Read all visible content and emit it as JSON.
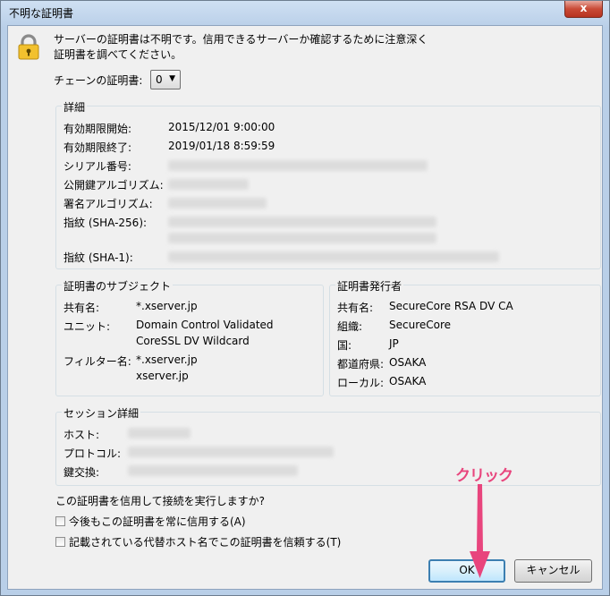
{
  "window": {
    "title": "不明な証明書",
    "close_label": "x"
  },
  "message": {
    "line1": "サーバーの証明書は不明です。信用できるサーバーか確認するために注意深く",
    "line2": "証明書を調べてください。"
  },
  "chain": {
    "label": "チェーンの証明書:",
    "selected": "0"
  },
  "details": {
    "legend": "詳細",
    "rows": [
      {
        "label": "有効期限開始:",
        "value": "2015/12/01 9:00:00"
      },
      {
        "label": "有効期限終了:",
        "value": "2019/01/18 8:59:59"
      },
      {
        "label": "シリアル番号:",
        "value": ""
      },
      {
        "label": "公開鍵アルゴリズム:",
        "value": ""
      },
      {
        "label": "署名アルゴリズム:",
        "value": ""
      },
      {
        "label": "指紋 (SHA-256):",
        "value": ""
      },
      {
        "label": "指紋 (SHA-1):",
        "value": ""
      }
    ]
  },
  "subject": {
    "legend": "証明書のサブジェクト",
    "cn_label": "共有名:",
    "cn_value": "*.xserver.jp",
    "unit_label": "ユニット:",
    "unit_value1": "Domain Control Validated",
    "unit_value2": "CoreSSL DV Wildcard",
    "filter_label": "フィルター名:",
    "filter_value1": "*.xserver.jp",
    "filter_value2": "xserver.jp"
  },
  "issuer": {
    "legend": "証明書発行者",
    "cn_label": "共有名:",
    "cn_value": "SecureCore RSA DV CA",
    "org_label": "組織:",
    "org_value": "SecureCore",
    "country_label": "国:",
    "country_value": "JP",
    "state_label": "都道府県:",
    "state_value": "OSAKA",
    "local_label": "ローカル:",
    "local_value": "OSAKA"
  },
  "session": {
    "legend": "セッション詳細",
    "host_label": "ホスト:",
    "protocol_label": "プロトコル:",
    "keyexchange_label": "鍵交換:"
  },
  "question": "この証明書を信用して接続を実行しますか?",
  "checkboxes": [
    {
      "label": "今後もこの証明書を常に信用する(A)",
      "checked": false
    },
    {
      "label": "記載されている代替ホスト名でこの証明書を信頼する(T)",
      "checked": false
    }
  ],
  "buttons": {
    "ok": "OK",
    "cancel": "キャンセル"
  },
  "annotation": {
    "text": "クリック",
    "color": "#e8457d"
  }
}
